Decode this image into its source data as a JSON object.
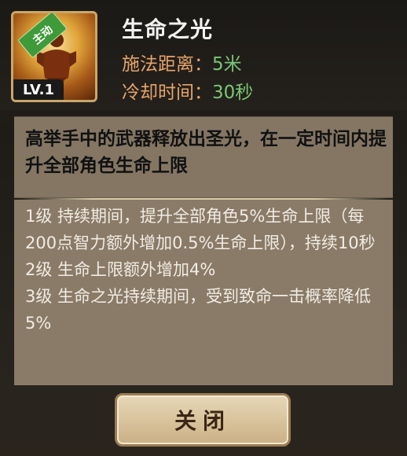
{
  "skill": {
    "tag": "主动",
    "level": "LV.1",
    "name": "生命之光",
    "range_label": "施法距离：",
    "range_value": "5米",
    "cooldown_label": "冷却时间：",
    "cooldown_value": "30秒"
  },
  "description": "高举手中的武器释放出圣光，在一定时间内提升全部角色生命上限",
  "level_details": [
    "1级 持续期间，提升全部角色5%生命上限（每200点智力额外增加0.5%生命上限），持续10秒",
    "2级 生命上限额外增加4%",
    "3级 生命之光持续期间，受到致命一击概率降低5%"
  ],
  "buttons": {
    "close": "关闭"
  },
  "colors": {
    "label_orange": "#e7a46a",
    "value_green": "#79c775",
    "tag_green": "#3f9a3a"
  },
  "icons": {
    "skill_icon": "glowing-muscular-figure-icon"
  }
}
